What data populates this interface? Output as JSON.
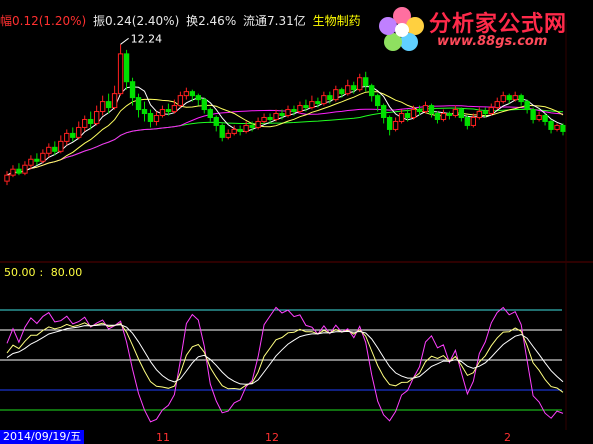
{
  "info_bar": {
    "amplitude_label": "幅0.12(1.20%)",
    "swing_label": "振0.24(2.40%)",
    "turnover_label": "换2.46%",
    "float_label": "流通7.31亿",
    "sector_label": "生物制药"
  },
  "logo": {
    "title": "分析家公式网",
    "url": "www.88gs.com"
  },
  "indicator_label": {
    "low": "50.00",
    "high": "80.00"
  },
  "date_box": "2014/09/19/五",
  "x_ticks": [
    {
      "label": "11",
      "index": 38
    },
    {
      "label": "12",
      "index": 64
    },
    {
      "label": "2",
      "index": 124
    }
  ],
  "colors": {
    "up": "#ff2020",
    "down": "#00e000",
    "ma_white": "#ffffff",
    "ma_yellow": "#ffff60",
    "ma_magenta": "#ff20ff",
    "ma_green": "#20ff20",
    "kdj_k": "#ff40ff",
    "kdj_d": "#ffffff",
    "kdj_j": "#ffff80",
    "ref_cyan": "#40e0e0",
    "ref_white": "#ffffff",
    "ref_blue": "#2040ff",
    "ref_green": "#20e020"
  },
  "chart_data": {
    "type": "candlestick",
    "price_ylim": [
      8.2,
      12.6
    ],
    "high_annotation": "12.24",
    "candles": [
      [
        8.8,
        8.95,
        8.7,
        9.05
      ],
      [
        8.95,
        9.1,
        8.9,
        9.2
      ],
      [
        9.1,
        9.0,
        8.95,
        9.25
      ],
      [
        9.0,
        9.2,
        8.95,
        9.3
      ],
      [
        9.2,
        9.35,
        9.1,
        9.45
      ],
      [
        9.35,
        9.3,
        9.2,
        9.5
      ],
      [
        9.3,
        9.5,
        9.25,
        9.6
      ],
      [
        9.5,
        9.65,
        9.4,
        9.75
      ],
      [
        9.65,
        9.55,
        9.45,
        9.8
      ],
      [
        9.55,
        9.8,
        9.5,
        9.95
      ],
      [
        9.8,
        10.0,
        9.7,
        10.1
      ],
      [
        10.0,
        9.9,
        9.8,
        10.15
      ],
      [
        9.9,
        10.15,
        9.85,
        10.3
      ],
      [
        10.15,
        10.35,
        10.05,
        10.45
      ],
      [
        10.35,
        10.25,
        10.1,
        10.55
      ],
      [
        10.25,
        10.55,
        10.2,
        10.7
      ],
      [
        10.55,
        10.8,
        10.45,
        10.95
      ],
      [
        10.8,
        10.65,
        10.5,
        11.0
      ],
      [
        10.65,
        11.0,
        10.6,
        11.2
      ],
      [
        11.0,
        12.0,
        10.95,
        12.24
      ],
      [
        12.0,
        11.3,
        11.1,
        12.1
      ],
      [
        11.3,
        10.9,
        10.7,
        11.4
      ],
      [
        10.9,
        10.6,
        10.4,
        11.0
      ],
      [
        10.6,
        10.5,
        10.3,
        10.8
      ],
      [
        10.5,
        10.3,
        10.15,
        10.6
      ],
      [
        10.3,
        10.45,
        10.2,
        10.55
      ],
      [
        10.45,
        10.6,
        10.4,
        10.7
      ],
      [
        10.6,
        10.55,
        10.45,
        10.75
      ],
      [
        10.55,
        10.7,
        10.5,
        10.85
      ],
      [
        10.7,
        10.95,
        10.65,
        11.05
      ],
      [
        10.95,
        11.05,
        10.85,
        11.15
      ],
      [
        11.05,
        10.95,
        10.8,
        11.1
      ],
      [
        10.95,
        10.85,
        10.7,
        11.0
      ],
      [
        10.85,
        10.6,
        10.5,
        10.9
      ],
      [
        10.6,
        10.4,
        10.3,
        10.65
      ],
      [
        10.4,
        10.2,
        10.05,
        10.45
      ],
      [
        10.2,
        9.9,
        9.8,
        10.25
      ],
      [
        9.9,
        10.0,
        9.85,
        10.1
      ],
      [
        10.0,
        10.1,
        9.95,
        10.2
      ],
      [
        10.1,
        10.05,
        9.95,
        10.2
      ],
      [
        10.05,
        10.2,
        10.0,
        10.3
      ],
      [
        10.2,
        10.15,
        10.05,
        10.3
      ],
      [
        10.15,
        10.3,
        10.1,
        10.4
      ],
      [
        10.3,
        10.4,
        10.25,
        10.5
      ],
      [
        10.4,
        10.35,
        10.25,
        10.5
      ],
      [
        10.35,
        10.5,
        10.3,
        10.6
      ],
      [
        10.5,
        10.45,
        10.35,
        10.6
      ],
      [
        10.45,
        10.6,
        10.4,
        10.7
      ],
      [
        10.6,
        10.55,
        10.45,
        10.7
      ],
      [
        10.55,
        10.7,
        10.5,
        10.8
      ],
      [
        10.7,
        10.65,
        10.55,
        10.85
      ],
      [
        10.65,
        10.8,
        10.6,
        10.95
      ],
      [
        10.8,
        10.75,
        10.65,
        10.9
      ],
      [
        10.75,
        10.95,
        10.7,
        11.05
      ],
      [
        10.95,
        10.85,
        10.75,
        11.05
      ],
      [
        10.85,
        11.1,
        10.8,
        11.2
      ],
      [
        11.1,
        11.0,
        10.9,
        11.15
      ],
      [
        11.0,
        11.2,
        10.95,
        11.35
      ],
      [
        11.2,
        11.1,
        11.0,
        11.3
      ],
      [
        11.1,
        11.4,
        11.05,
        11.5
      ],
      [
        11.4,
        11.2,
        11.05,
        11.55
      ],
      [
        11.2,
        10.95,
        10.8,
        11.25
      ],
      [
        10.95,
        10.7,
        10.55,
        11.0
      ],
      [
        10.7,
        10.4,
        10.25,
        10.75
      ],
      [
        10.4,
        10.1,
        9.95,
        10.45
      ],
      [
        10.1,
        10.3,
        10.05,
        10.4
      ],
      [
        10.3,
        10.5,
        10.25,
        10.6
      ],
      [
        10.5,
        10.4,
        10.3,
        10.6
      ],
      [
        10.4,
        10.6,
        10.35,
        10.7
      ],
      [
        10.6,
        10.55,
        10.45,
        10.7
      ],
      [
        10.55,
        10.7,
        10.5,
        10.8
      ],
      [
        10.7,
        10.5,
        10.4,
        10.75
      ],
      [
        10.5,
        10.35,
        10.25,
        10.55
      ],
      [
        10.35,
        10.5,
        10.3,
        10.6
      ],
      [
        10.5,
        10.45,
        10.35,
        10.55
      ],
      [
        10.45,
        10.6,
        10.4,
        10.7
      ],
      [
        10.6,
        10.4,
        10.3,
        10.65
      ],
      [
        10.4,
        10.2,
        10.1,
        10.45
      ],
      [
        10.2,
        10.4,
        10.15,
        10.5
      ],
      [
        10.4,
        10.55,
        10.35,
        10.65
      ],
      [
        10.55,
        10.5,
        10.4,
        10.65
      ],
      [
        10.5,
        10.65,
        10.45,
        10.75
      ],
      [
        10.65,
        10.8,
        10.6,
        10.9
      ],
      [
        10.8,
        10.95,
        10.75,
        11.05
      ],
      [
        10.95,
        10.85,
        10.75,
        11.0
      ],
      [
        10.85,
        10.95,
        10.8,
        11.05
      ],
      [
        10.95,
        10.8,
        10.7,
        11.0
      ],
      [
        10.8,
        10.6,
        10.5,
        10.85
      ],
      [
        10.6,
        10.35,
        10.25,
        10.65
      ],
      [
        10.35,
        10.45,
        10.3,
        10.55
      ],
      [
        10.45,
        10.3,
        10.2,
        10.5
      ],
      [
        10.3,
        10.1,
        10.0,
        10.35
      ],
      [
        10.1,
        10.2,
        10.05,
        10.25
      ],
      [
        10.2,
        10.05,
        9.95,
        10.25
      ]
    ],
    "indicator_ylim": [
      -20,
      120
    ],
    "reference_lines": [
      100,
      80,
      50,
      20,
      0
    ]
  }
}
